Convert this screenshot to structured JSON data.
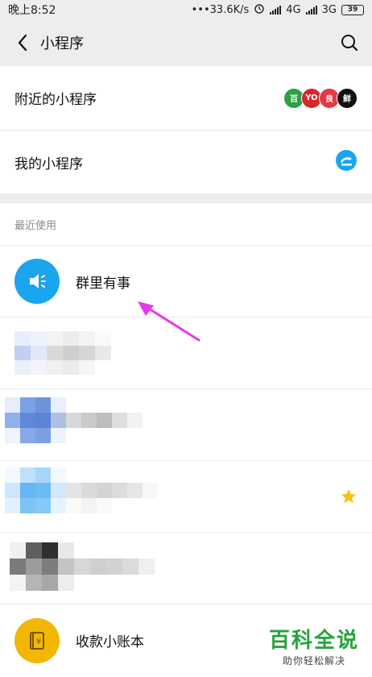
{
  "status_bar": {
    "time": "晚上8:52",
    "network_speed": "•••33.6K/s",
    "network_4g": "4G",
    "network_3g": "3G",
    "battery": "39"
  },
  "nav": {
    "title": "小程序"
  },
  "menu": {
    "nearby_label": "附近的小程序",
    "mine_label": "我的小程序",
    "nearby_logo_texts": [
      "百",
      "YO",
      "良",
      "鲜"
    ]
  },
  "recent": {
    "header": "最近使用",
    "apps": [
      {
        "name": "群里有事",
        "blurred": false,
        "starred": false
      },
      {
        "name": "",
        "blurred": true,
        "starred": false
      },
      {
        "name": "",
        "blurred": true,
        "starred": false
      },
      {
        "name": "",
        "blurred": true,
        "starred": true
      },
      {
        "name": "",
        "blurred": true,
        "starred": false
      },
      {
        "name": "收款小账本",
        "blurred": false,
        "starred": false
      }
    ]
  },
  "colors": {
    "accent_blue": "#1aa5ee",
    "arrow_magenta": "#e639e6",
    "star_yellow": "#f5c518",
    "ledger_yellow": "#f2b705",
    "watermark_green": "#27a33d"
  },
  "watermark": {
    "main": "百科全说",
    "sub": "助你轻松解决"
  }
}
